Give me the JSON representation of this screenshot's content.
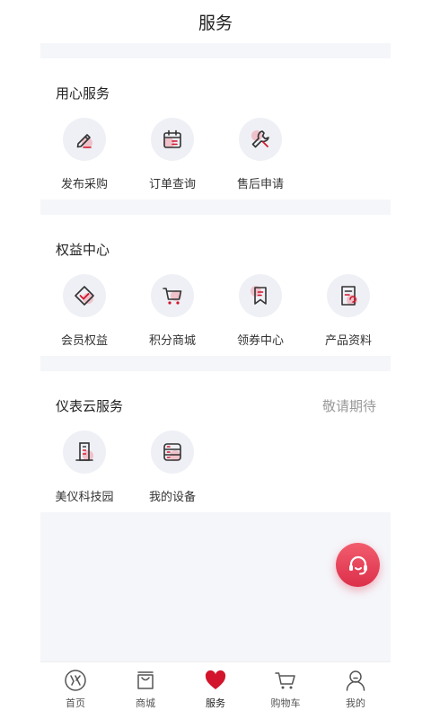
{
  "header": {
    "title": "服务"
  },
  "sections": [
    {
      "title": "用心服务",
      "note": "",
      "items": [
        {
          "label": "发布采购",
          "icon": "pencil-icon"
        },
        {
          "label": "订单查询",
          "icon": "order-calendar-icon"
        },
        {
          "label": "售后申请",
          "icon": "wrench-icon"
        }
      ]
    },
    {
      "title": "权益中心",
      "note": "",
      "items": [
        {
          "label": "会员权益",
          "icon": "diamond-check-icon"
        },
        {
          "label": "积分商城",
          "icon": "cart-icon"
        },
        {
          "label": "领券中心",
          "icon": "bookmark-icon"
        },
        {
          "label": "产品资料",
          "icon": "document-icon"
        }
      ]
    },
    {
      "title": "仪表云服务",
      "note": "敬请期待",
      "items": [
        {
          "label": "美仪科技园",
          "icon": "building-icon"
        },
        {
          "label": "我的设备",
          "icon": "device-list-icon"
        }
      ]
    }
  ],
  "support": {
    "icon": "headset-icon"
  },
  "tabbar": {
    "active_color": "#d2152c",
    "items": [
      {
        "label": "首页",
        "icon": "home-logo-icon",
        "active": false
      },
      {
        "label": "商城",
        "icon": "bag-icon",
        "active": false
      },
      {
        "label": "服务",
        "icon": "heart-icon",
        "active": true
      },
      {
        "label": "购物车",
        "icon": "cart-icon",
        "active": false
      },
      {
        "label": "我的",
        "icon": "user-icon",
        "active": false
      }
    ]
  },
  "colors": {
    "accent": "#d2152c",
    "accent_soft": "#f06a7b",
    "page_bg": "#f5f6fa",
    "icon_circle": "#eef0f5"
  }
}
